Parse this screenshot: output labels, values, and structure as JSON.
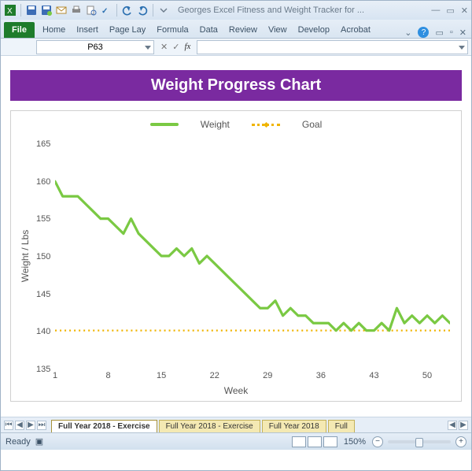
{
  "titlebar": {
    "doc_title": "Georges Excel Fitness and Weight Tracker for ..."
  },
  "ribbon": {
    "file": "File",
    "tabs": [
      "Home",
      "Insert",
      "Page Lay",
      "Formula",
      "Data",
      "Review",
      "View",
      "Develop",
      "Acrobat"
    ]
  },
  "fx": {
    "name_box": "P63",
    "fx_label": "fx",
    "formula": ""
  },
  "chart_title": "Weight Progress Chart",
  "legend": {
    "series1": "Weight",
    "series2": "Goal"
  },
  "axes": {
    "ylabel": "Weight / Lbs",
    "xlabel": "Week",
    "yticks": [
      "165",
      "160",
      "155",
      "150",
      "145",
      "140",
      "135"
    ],
    "xticks": [
      "1",
      "8",
      "15",
      "22",
      "29",
      "36",
      "43",
      "50"
    ]
  },
  "sheet_tabs": {
    "t1": "Full Year 2018 - Exercise",
    "t2": "Full Year 2018 - Exercise",
    "t3": "Full Year 2018",
    "t4": "Full"
  },
  "status": {
    "ready": "Ready",
    "zoom": "150%"
  },
  "chart_data": {
    "type": "line",
    "title": "Weight Progress Chart",
    "xlabel": "Week",
    "ylabel": "Weight / Lbs",
    "xlim": [
      1,
      53
    ],
    "ylim": [
      135,
      165
    ],
    "x": [
      1,
      2,
      3,
      4,
      5,
      6,
      7,
      8,
      9,
      10,
      11,
      12,
      13,
      14,
      15,
      16,
      17,
      18,
      19,
      20,
      21,
      22,
      23,
      24,
      25,
      26,
      27,
      28,
      29,
      30,
      31,
      32,
      33,
      34,
      35,
      36,
      37,
      38,
      39,
      40,
      41,
      42,
      43,
      44,
      45,
      46,
      47,
      48,
      49,
      50,
      51,
      52,
      53
    ],
    "series": [
      {
        "name": "Weight",
        "values": [
          160,
          158,
          158,
          158,
          157,
          156,
          155,
          155,
          154,
          153,
          155,
          153,
          152,
          151,
          150,
          150,
          151,
          150,
          151,
          149,
          150,
          149,
          148,
          147,
          146,
          145,
          144,
          143,
          143,
          144,
          142,
          143,
          142,
          142,
          141,
          141,
          141,
          140,
          141,
          140,
          141,
          140,
          140,
          141,
          140,
          143,
          141,
          142,
          141,
          142,
          141,
          142,
          141
        ]
      },
      {
        "name": "Goal",
        "values": [
          140,
          140,
          140,
          140,
          140,
          140,
          140,
          140,
          140,
          140,
          140,
          140,
          140,
          140,
          140,
          140,
          140,
          140,
          140,
          140,
          140,
          140,
          140,
          140,
          140,
          140,
          140,
          140,
          140,
          140,
          140,
          140,
          140,
          140,
          140,
          140,
          140,
          140,
          140,
          140,
          140,
          140,
          140,
          140,
          140,
          140,
          140,
          140,
          140,
          140,
          140,
          140,
          140
        ]
      }
    ],
    "legend_position": "top"
  }
}
